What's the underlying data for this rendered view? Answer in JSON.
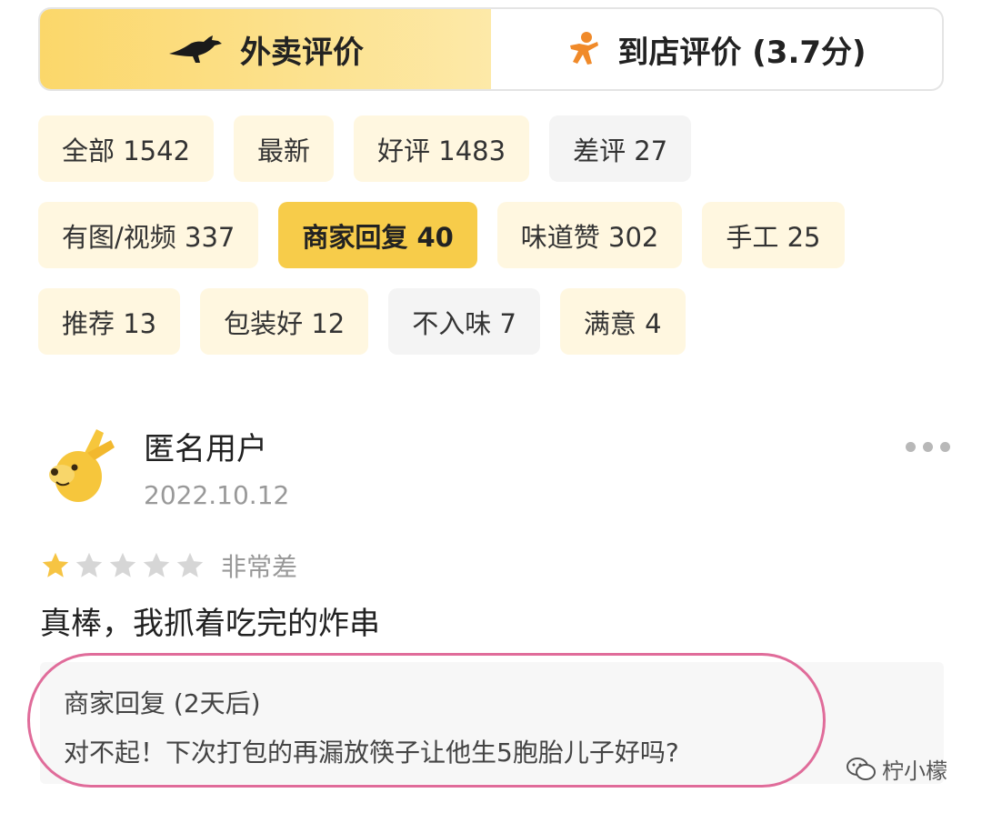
{
  "tabs": [
    {
      "label": "外卖评价",
      "active": true,
      "icon": "kangaroo-logo-icon"
    },
    {
      "label": "到店评价 (3.7分)",
      "active": false,
      "icon": "person-running-icon"
    }
  ],
  "filters": {
    "rows": [
      [
        {
          "label": "全部 1542",
          "type": "positive"
        },
        {
          "label": "最新",
          "type": "positive"
        },
        {
          "label": "好评 1483",
          "type": "positive"
        },
        {
          "label": "差评 27",
          "type": "negative"
        }
      ],
      [
        {
          "label": "有图/视频 337",
          "type": "positive"
        },
        {
          "label": "商家回复 40",
          "type": "active"
        },
        {
          "label": "味道赞 302",
          "type": "positive"
        },
        {
          "label": "手工 25",
          "type": "positive"
        }
      ],
      [
        {
          "label": "推荐 13",
          "type": "positive"
        },
        {
          "label": "包装好 12",
          "type": "positive"
        },
        {
          "label": "不入味 7",
          "type": "negative"
        },
        {
          "label": "满意 4",
          "type": "positive"
        }
      ]
    ]
  },
  "review": {
    "user_name": "匿名用户",
    "date": "2022.10.12",
    "rating": 1,
    "max_rating": 5,
    "rating_text": "非常差",
    "content": "真棒，我抓着吃完的炸串",
    "reply": {
      "title": "商家回复 (2天后)",
      "text": "对不起！下次打包的再漏放筷子让他生5胞胎儿子好吗?"
    }
  },
  "watermark": "柠小檬",
  "colors": {
    "accent": "#f7cc4a",
    "chip_bg": "#fff7e0",
    "chip_negative_bg": "#f4f4f4",
    "star_on": "#f6c443",
    "star_off": "#d6d6d6",
    "highlight": "#e06c9a"
  }
}
